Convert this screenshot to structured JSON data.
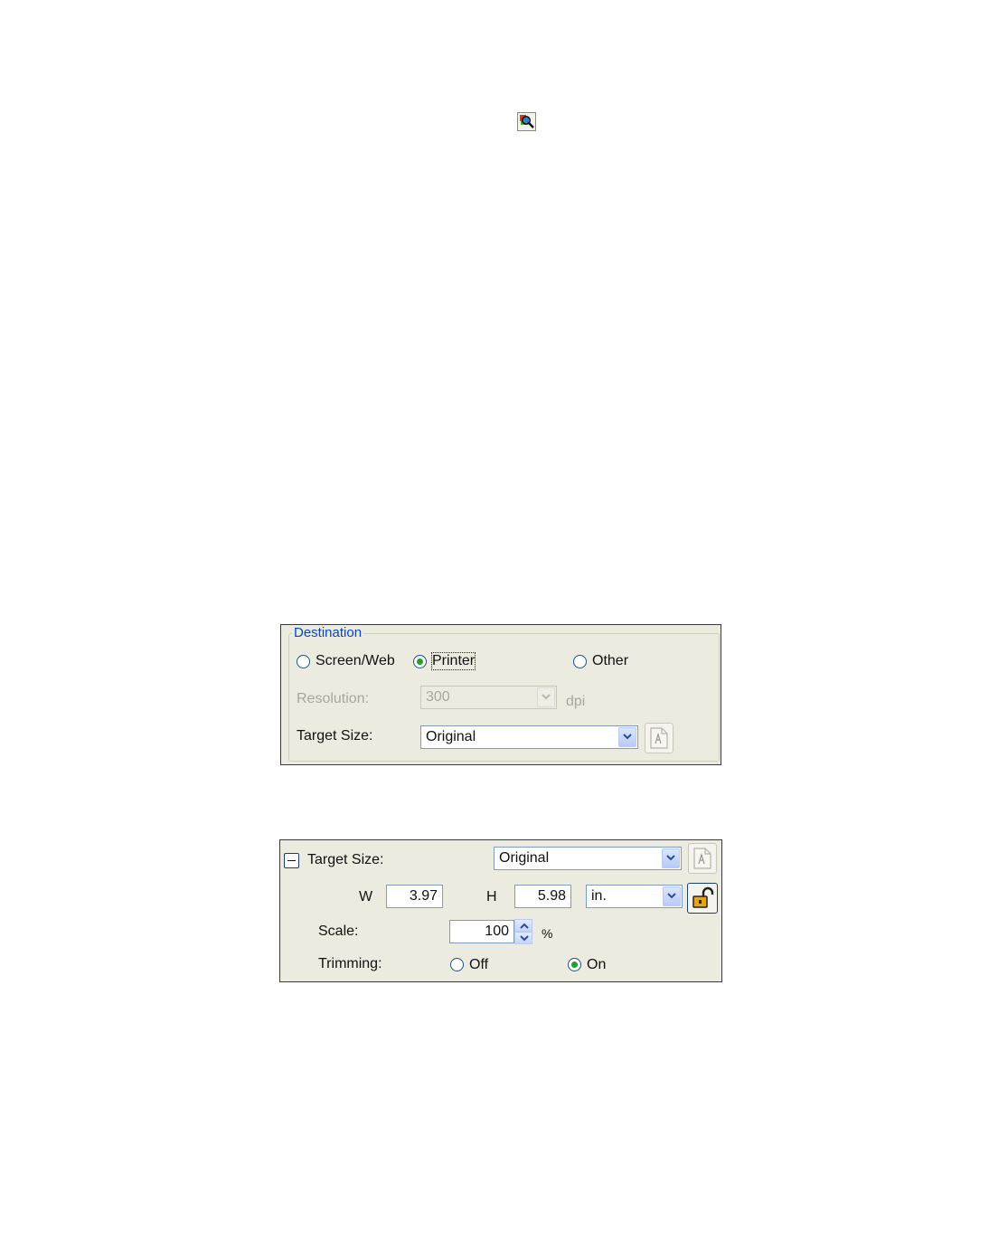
{
  "top_icon": {
    "name": "zoom-preview-icon"
  },
  "destination_panel": {
    "group_title": "Destination",
    "radios": [
      {
        "label": "Screen/Web",
        "checked": false
      },
      {
        "label": "Printer",
        "checked": true
      },
      {
        "label": "Other",
        "checked": false
      }
    ],
    "resolution": {
      "label": "Resolution:",
      "value": "300",
      "unit": "dpi",
      "enabled": false
    },
    "target_size": {
      "label": "Target Size:",
      "value": "Original"
    }
  },
  "target_size_panel": {
    "label": "Target Size:",
    "value": "Original",
    "width": {
      "label": "W",
      "value": "3.97"
    },
    "height": {
      "label": "H",
      "value": "5.98"
    },
    "unit": "in.",
    "scale": {
      "label": "Scale:",
      "value": "100",
      "unit": "%"
    },
    "trimming": {
      "label": "Trimming:",
      "options": [
        {
          "label": "Off",
          "checked": false
        },
        {
          "label": "On",
          "checked": true
        }
      ]
    }
  },
  "colors": {
    "panel_bg": "#ecebe0",
    "group_title": "#0046d5",
    "radio_dot": "#21a121",
    "disabled_text": "#a8a899",
    "field_border": "#7f9db9"
  }
}
